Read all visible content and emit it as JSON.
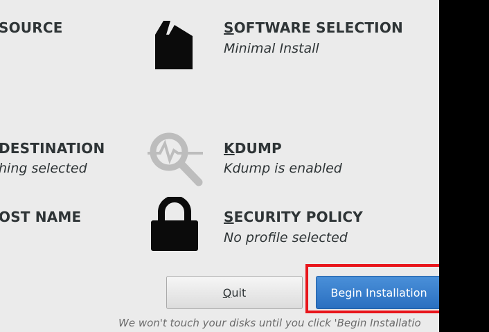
{
  "spokes": {
    "source_title": "SOURCE",
    "software_title": "SOFTWARE SELECTION",
    "software_sub": "Minimal Install",
    "destination_title": "DESTINATION",
    "destination_sub": "hing selected",
    "kdump_title": "KDUMP",
    "kdump_sub": "Kdump is enabled",
    "hostname_title": "OST NAME",
    "security_title": "SECURITY POLICY",
    "security_sub": "No profile selected"
  },
  "buttons": {
    "quit_label": "Quit",
    "begin_label": "Begin Installation"
  },
  "footer_note": "We won't touch your disks until you click 'Begin Installatio",
  "colors": {
    "highlight": "#e8151b",
    "primary_button": "#3a80d0",
    "background": "#ebebeb"
  },
  "icons": {
    "software": "package-icon",
    "kdump": "magnifier-icon",
    "security": "lock-icon"
  }
}
